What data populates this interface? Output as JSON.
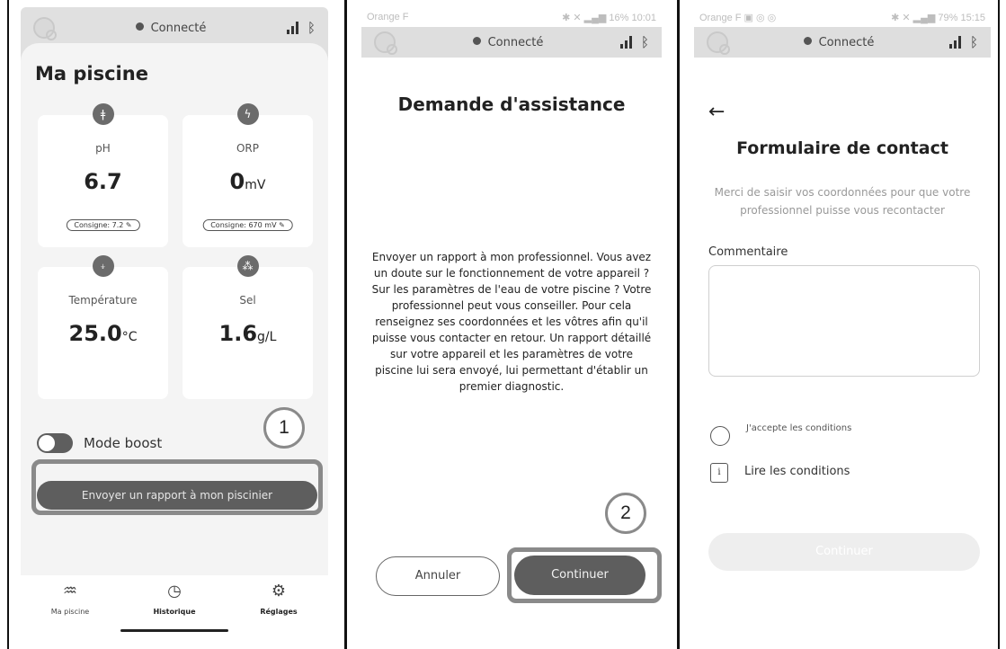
{
  "panel1": {
    "status": {
      "connection": "Connecté"
    },
    "title": "Ma piscine",
    "metrics": [
      {
        "label": "pH",
        "value": "6.7",
        "unit": "",
        "setpoint": "Consigne: 7.2",
        "icon": "thermometer-probe-icon"
      },
      {
        "label": "ORP",
        "value": "0",
        "unit": "mV",
        "setpoint": "Consigne: 670 mV",
        "icon": "orp-drop-icon"
      },
      {
        "label": "Température",
        "value": "25.0",
        "unit": "°C",
        "setpoint": "",
        "icon": "thermometer-icon"
      },
      {
        "label": "Sel",
        "value": "1.6",
        "unit": "g/L",
        "setpoint": "",
        "icon": "salt-icon"
      }
    ],
    "boost_label": "Mode boost",
    "boost_on": false,
    "badge": "1",
    "send_button": "Envoyer un rapport à mon piscinier",
    "tabs": [
      {
        "label": "Ma piscine",
        "icon": "pool-ladder-icon"
      },
      {
        "label": "Historique",
        "icon": "clock-icon"
      },
      {
        "label": "Réglages",
        "icon": "gear-icon"
      }
    ]
  },
  "panel2": {
    "os_status": {
      "carrier": "Orange F",
      "right": "16% 10:01"
    },
    "status": {
      "connection": "Connecté"
    },
    "title": "Demande d'assistance",
    "body": "Envoyer un rapport à mon professionnel. Vous avez un doute sur le fonctionnement de votre appareil ? Sur les paramètres de l'eau de votre piscine ? Votre professionnel peut vous conseiller. Pour cela renseignez ses coordonnées et les vôtres afin qu'il puisse vous contacter en retour. Un rapport détaillé sur votre appareil et les paramètres de votre piscine lui sera envoyé, lui permettant d'établir un premier diagnostic.",
    "badge": "2",
    "cancel_button": "Annuler",
    "continue_button": "Continuer"
  },
  "panel3": {
    "os_status": {
      "carrier": "Orange F",
      "right": "79% 15:15"
    },
    "status": {
      "connection": "Connecté"
    },
    "back": "←",
    "title": "Formulaire de contact",
    "subtitle": "Merci de saisir vos coordonnées pour que votre professionnel puisse vous recontacter",
    "comment_label": "Commentaire",
    "comment_value": "",
    "accept_label": "J'accepte les conditions",
    "info_glyph": "i",
    "read_label": "Lire les conditions",
    "continue_button": "Continuer"
  }
}
